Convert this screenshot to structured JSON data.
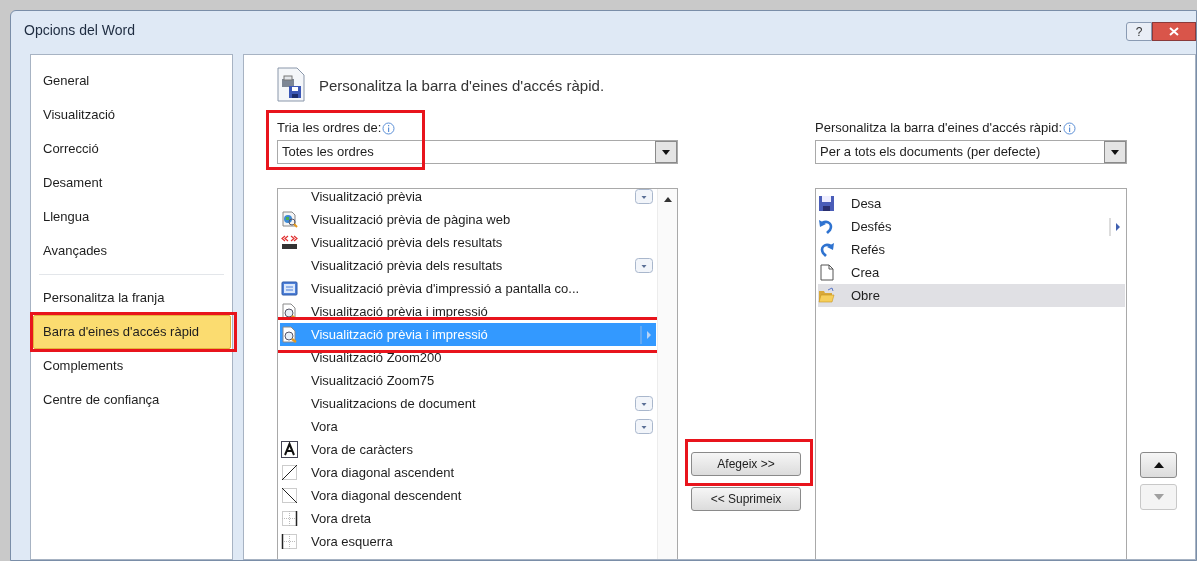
{
  "window": {
    "title": "Opcions del Word"
  },
  "title_buttons": [
    {
      "kind": "help",
      "label": "?"
    },
    {
      "kind": "close"
    }
  ],
  "nav": {
    "sections": [
      {
        "items": [
          {
            "label": "General",
            "selected": false,
            "highlighted": false
          },
          {
            "label": "Visualització",
            "selected": false,
            "highlighted": false
          },
          {
            "label": "Correcció",
            "selected": false,
            "highlighted": false
          },
          {
            "label": "Desament",
            "selected": false,
            "highlighted": false
          },
          {
            "label": "Llengua",
            "selected": false,
            "highlighted": false
          },
          {
            "label": "Avançades",
            "selected": false,
            "highlighted": false
          }
        ]
      },
      {
        "items": [
          {
            "label": "Personalitza la franja",
            "selected": false,
            "highlighted": false
          },
          {
            "label": "Barra d'eines d'accés ràpid",
            "selected": true,
            "highlighted": true
          },
          {
            "label": "Complements",
            "selected": false,
            "highlighted": false
          },
          {
            "label": "Centre de confiança",
            "selected": false,
            "highlighted": false
          }
        ]
      }
    ]
  },
  "header": {
    "title": "Personalitza la barra d'eines d'accés ràpid."
  },
  "commands": {
    "label": "Tria les ordres de:",
    "highlighted": true,
    "dropdown": {
      "value": "Totes les ordres"
    },
    "items": [
      {
        "label": "Visualització prèvia",
        "kind": "plain",
        "dropdown": true,
        "submenu": false,
        "selected": false,
        "highlighted": false
      },
      {
        "label": "Visualització prèvia de pàgina web",
        "kind": "web-preview",
        "dropdown": false,
        "submenu": false,
        "selected": false,
        "highlighted": false
      },
      {
        "label": "Visualització prèvia dels resultats",
        "kind": "abc",
        "dropdown": false,
        "submenu": false,
        "selected": false,
        "highlighted": false
      },
      {
        "label": "Visualització prèvia dels resultats",
        "kind": "plain",
        "dropdown": true,
        "submenu": false,
        "selected": false,
        "highlighted": false
      },
      {
        "label": "Visualització prèvia d'impressió a pantalla co...",
        "kind": "screen",
        "dropdown": false,
        "submenu": false,
        "selected": false,
        "highlighted": false
      },
      {
        "label": "Visualització prèvia i impressió",
        "kind": "doc-magnifier",
        "dropdown": false,
        "submenu": false,
        "selected": false,
        "highlighted": false
      },
      {
        "label": "Visualització prèvia i impressió",
        "kind": "doc-magnifier",
        "dropdown": false,
        "submenu": true,
        "selected": true,
        "highlighted": true
      },
      {
        "label": "Visualització Zoom200",
        "kind": "plain",
        "dropdown": false,
        "submenu": false,
        "selected": false,
        "highlighted": false
      },
      {
        "label": "Visualització Zoom75",
        "kind": "plain",
        "dropdown": false,
        "submenu": false,
        "selected": false,
        "highlighted": false
      },
      {
        "label": "Visualitzacions de document",
        "kind": "plain",
        "dropdown": true,
        "submenu": false,
        "selected": false,
        "highlighted": false
      },
      {
        "label": "Vora",
        "kind": "plain",
        "dropdown": true,
        "submenu": false,
        "selected": false,
        "highlighted": false
      },
      {
        "label": "Vora de caràcters",
        "kind": "char-border",
        "dropdown": false,
        "submenu": false,
        "selected": false,
        "highlighted": false
      },
      {
        "label": "Vora diagonal ascendent",
        "kind": "diag-up",
        "dropdown": false,
        "submenu": false,
        "selected": false,
        "highlighted": false
      },
      {
        "label": "Vora diagonal descendent",
        "kind": "diag-down",
        "dropdown": false,
        "submenu": false,
        "selected": false,
        "highlighted": false
      },
      {
        "label": "Vora dreta",
        "kind": "border-right",
        "dropdown": false,
        "submenu": false,
        "selected": false,
        "highlighted": false
      },
      {
        "label": "Vora esquerra",
        "kind": "border-left",
        "dropdown": false,
        "submenu": false,
        "selected": false,
        "highlighted": false
      }
    ]
  },
  "buttons": [
    {
      "label": "Afegeix >>",
      "highlighted": true
    },
    {
      "label": "<< Suprimeix",
      "highlighted": false
    }
  ],
  "toolbar": {
    "label": "Personalitza la barra d'eines d'accés ràpid:",
    "dropdown": {
      "value": "Per a tots els documents (per defecte)"
    },
    "items": [
      {
        "label": "Desa",
        "kind": "save",
        "submenu": false,
        "selected": false
      },
      {
        "label": "Desfés",
        "kind": "undo",
        "submenu": true,
        "selected": false
      },
      {
        "label": "Refés",
        "kind": "redo",
        "submenu": false,
        "selected": false
      },
      {
        "label": "Crea",
        "kind": "new",
        "submenu": false,
        "selected": false
      },
      {
        "label": "Obre",
        "kind": "open",
        "submenu": false,
        "selected": true
      }
    ]
  },
  "move_buttons": [
    {
      "kind": "up",
      "disabled": false
    },
    {
      "kind": "down",
      "disabled": true
    }
  ]
}
